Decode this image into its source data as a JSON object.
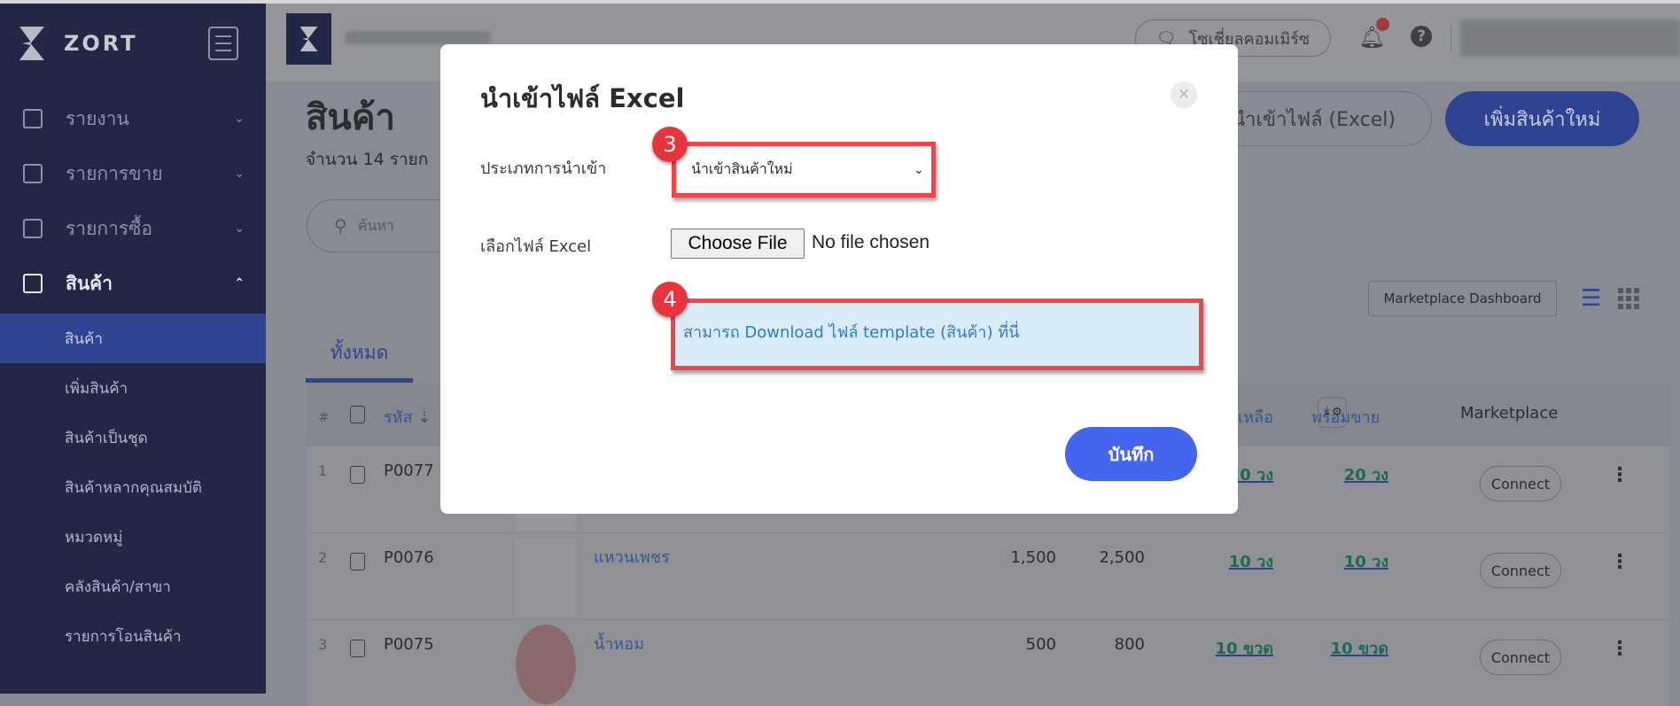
{
  "sidebar": {
    "brand": "ZORT",
    "items": [
      {
        "label": "รายงาน",
        "icon": "chart-icon"
      },
      {
        "label": "รายการขาย",
        "icon": "clipboard-icon"
      },
      {
        "label": "รายการซื้อ",
        "icon": "basket-icon"
      },
      {
        "label": "สินค้า",
        "icon": "box-icon",
        "expanded": true
      }
    ],
    "sub_items": [
      "สินค้า",
      "เพิ่มสินค้า",
      "สินค้าเป็นชุด",
      "สินค้าหลากคุณสมบัติ",
      "หมวดหมู่",
      "คลังสินค้า/สาขา",
      "รายการโอนสินค้า"
    ],
    "active_sub": "สินค้า"
  },
  "header": {
    "social_commerce": "โซเชี่ยลคอมเมิร์ซ"
  },
  "page": {
    "title": "สินค้า",
    "subtitle": "จำนวน 14 รายก",
    "search_placeholder": "ค้นหา",
    "import_button": "นำเข้าไฟล์ (Excel)",
    "add_button": "เพิ่มสินค้าใหม่",
    "marketplace_dashboard": "Marketplace Dashboard",
    "tab_all": "ทั้งหมด"
  },
  "table": {
    "headers": {
      "index": "#",
      "code": "รหัส",
      "remaining": "เหลือ",
      "available": "พร้อมขาย",
      "marketplace": "Marketplace"
    },
    "rows": [
      {
        "index": "1",
        "code": "P0077",
        "name": "",
        "cost": "",
        "price": "",
        "remaining": "20 วง",
        "available": "20 วง",
        "action": "Connect"
      },
      {
        "index": "2",
        "code": "P0076",
        "name": "แหวนเพชร",
        "cost": "1,500",
        "price": "2,500",
        "remaining": "10 วง",
        "available": "10 วง",
        "action": "Connect"
      },
      {
        "index": "3",
        "code": "P0075",
        "name": "น้ำหอม",
        "cost": "500",
        "price": "800",
        "remaining": "10 ขวด",
        "available": "10 ขวด",
        "action": "Connect"
      }
    ]
  },
  "modal": {
    "title": "นำเข้าไฟล์ Excel",
    "import_type_label": "ประเภทการนำเข้า",
    "import_type_value": "นำเข้าสินค้าใหม่",
    "file_label": "เลือกไฟล์ Excel",
    "choose_file": "Choose File",
    "no_file": "No file chosen",
    "download_link": "สามารถ Download ไฟล์ template (สินค้า) ที่นี่",
    "save": "บันทึก",
    "step_badges": [
      "3",
      "4"
    ]
  },
  "colors": {
    "sidebar": "#222745",
    "primary": "#4466ee",
    "annotation": "#f4444a",
    "link": "#2d7ec4",
    "info_bg": "#d9ebf6"
  }
}
